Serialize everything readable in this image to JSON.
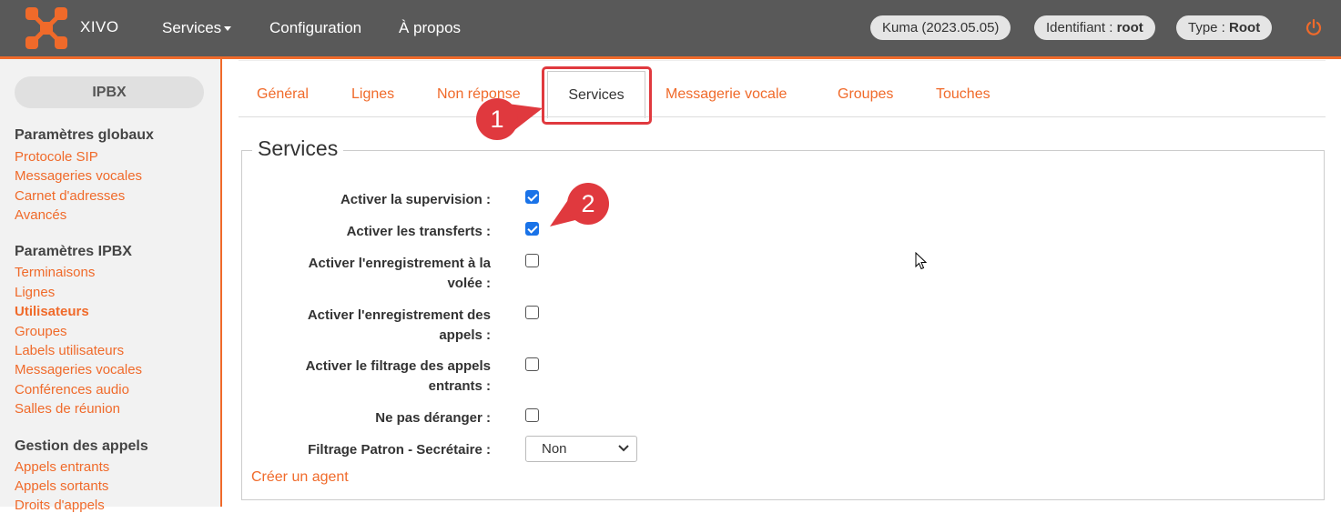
{
  "header": {
    "brand": "XIVO",
    "nav": {
      "services": "Services",
      "configuration": "Configuration",
      "apropos": "À propos"
    },
    "version": "Kuma (2023.05.05)",
    "identifiant_label": "Identifiant : ",
    "identifiant_value": "root",
    "type_label": "Type : ",
    "type_value": "Root"
  },
  "sidebar": {
    "button": "IPBX",
    "sections": [
      {
        "title": "Paramètres globaux",
        "items": [
          "Protocole SIP",
          "Messageries vocales",
          "Carnet d'adresses",
          "Avancés"
        ]
      },
      {
        "title": "Paramètres IPBX",
        "items": [
          "Terminaisons",
          "Lignes",
          "Utilisateurs",
          "Groupes",
          "Labels utilisateurs",
          "Messageries vocales",
          "Conférences audio",
          "Salles de réunion"
        ],
        "active": "Utilisateurs"
      },
      {
        "title": "Gestion des appels",
        "items": [
          "Appels entrants",
          "Appels sortants",
          "Droits d'appels"
        ]
      }
    ]
  },
  "tabs": [
    "Général",
    "Lignes",
    "Non réponse",
    "Services",
    "Messagerie vocale",
    "Groupes",
    "Touches"
  ],
  "active_tab": "Services",
  "form": {
    "legend": "Services",
    "fields": [
      {
        "label": "Activer la supervision :",
        "checked": true
      },
      {
        "label": "Activer les transferts :",
        "checked": true
      },
      {
        "label_line1": "Activer l'enregistrement à la",
        "label_line2": "volée :",
        "checked": false
      },
      {
        "label_line1": "Activer l'enregistrement des",
        "label_line2": "appels :",
        "checked": false
      },
      {
        "label_line1": "Activer le filtrage des appels",
        "label_line2": "entrants :",
        "checked": false
      },
      {
        "label": "Ne pas déranger :",
        "checked": false
      },
      {
        "label": "Filtrage Patron - Secrétaire :",
        "select_value": "Non"
      }
    ],
    "create_agent_link": "Créer un agent"
  },
  "annotations": {
    "step1": "1",
    "step2": "2"
  },
  "colors": {
    "accent": "#f06a2a",
    "topbar": "#595959",
    "annotation": "#e0393e",
    "checkbox": "#1a73e8"
  }
}
